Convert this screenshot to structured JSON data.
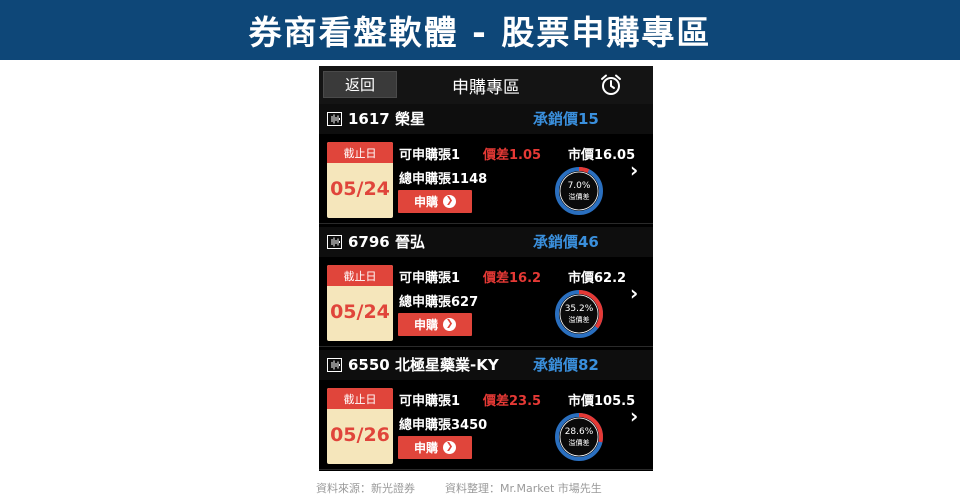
{
  "banner": {
    "title": "券商看盤軟體 - 股票申購專區"
  },
  "topbar": {
    "back_label": "返回",
    "title": "申購專區",
    "alarm_icon": "alarm-clock-icon"
  },
  "cards": [
    {
      "stock": "1617 榮星",
      "offer_price": "承銷價15",
      "deadline_label": "截止日",
      "deadline": "05/24",
      "can_buy": "可申購張1",
      "spread": "價差1.05",
      "market_price": "市價16.05",
      "total_buy": "總申購張1148",
      "button_label": "申購",
      "premium_pct": "7.0%",
      "premium_value": 7.0,
      "premium_label": "溢價差"
    },
    {
      "stock": "6796 晉弘",
      "offer_price": "承銷價46",
      "deadline_label": "截止日",
      "deadline": "05/24",
      "can_buy": "可申購張1",
      "spread": "價差16.2",
      "market_price": "市價62.2",
      "total_buy": "總申購張627",
      "button_label": "申購",
      "premium_pct": "35.2%",
      "premium_value": 35.2,
      "premium_label": "溢價差"
    },
    {
      "stock": "6550 北極星藥業-KY",
      "offer_price": "承銷價82",
      "deadline_label": "截止日",
      "deadline": "05/26",
      "can_buy": "可申購張1",
      "spread": "價差23.5",
      "market_price": "市價105.5",
      "total_buy": "總申購張3450",
      "button_label": "申購",
      "premium_pct": "28.6%",
      "premium_value": 28.6,
      "premium_label": "溢價差"
    }
  ],
  "source": {
    "left": "資料來源：新光證券",
    "right": "資料整理：Mr.Market 市場先生"
  },
  "colors": {
    "banner": "#0e4778",
    "accent_red": "#e53935",
    "offer_blue": "#3a8fdc",
    "gauge_ring": "#2a6fbf"
  }
}
